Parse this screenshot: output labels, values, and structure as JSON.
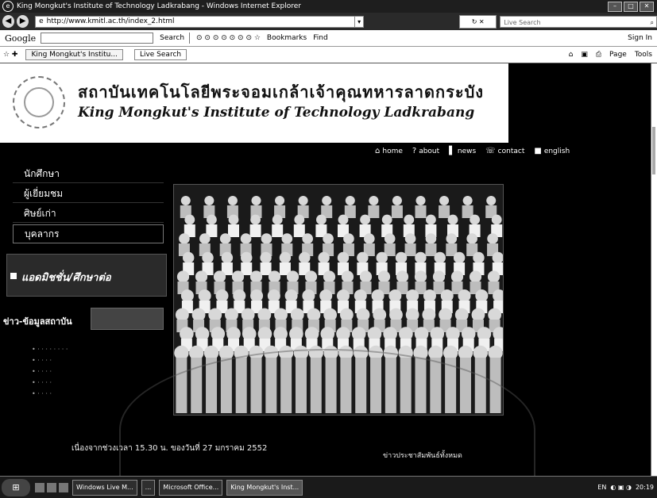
{
  "window": {
    "title": "King Mongkut's Institute of Technology Ladkrabang - Windows Internet Explorer"
  },
  "address_bar": {
    "url": "http://www.kmitl.ac.th/index_2.html",
    "search_placeholder": "Live Search"
  },
  "google_toolbar": {
    "label": "Google",
    "search_label": "Search",
    "bookmarks_label": "Bookmarks",
    "find_label": "Find",
    "sign_in_label": "Sign In"
  },
  "tabs": [
    {
      "label": "King Mongkut's Institu..."
    },
    {
      "label": "Live Search"
    }
  ],
  "command_bar": {
    "page_label": "Page",
    "tools_label": "Tools"
  },
  "page": {
    "title_th": "สถาบันเทคโนโลยีพระจอมเกล้าเจ้าคุณทหารลาดกระบัง",
    "title_en": "King Mongkut's Institute of Technology Ladkrabang",
    "top_nav": [
      {
        "label": "home",
        "icon": "home-icon"
      },
      {
        "label": "about",
        "icon": "question-icon"
      },
      {
        "label": "news",
        "icon": "news-icon"
      },
      {
        "label": "contact",
        "icon": "contact-icon"
      },
      {
        "label": "english",
        "icon": "flag-icon"
      }
    ],
    "left_menu": [
      {
        "label": "นักศึกษา"
      },
      {
        "label": "ผู้เยี่ยมชม"
      },
      {
        "label": "ศิษย์เก่า"
      },
      {
        "label": "บุคลากร"
      }
    ],
    "admission_label": "แอดมิชชั่น/ศึกษาต่อ",
    "news_label": "ข่าว-ข้อมูลสถาบัน",
    "bottom_text": "เนื่องจากช่วงเวลา 15.30 น. ของวันที่ 27 มกราคม 2552",
    "right_note": "ข่าวประชาสัมพันธ์ทั้งหมด"
  },
  "taskbar": {
    "items": [
      {
        "label": "Windows Live M..."
      },
      {
        "label": "..."
      },
      {
        "label": "Microsoft Office..."
      },
      {
        "label": "King Mongkut's Inst..."
      }
    ],
    "lang": "EN",
    "clock": "20:19"
  }
}
